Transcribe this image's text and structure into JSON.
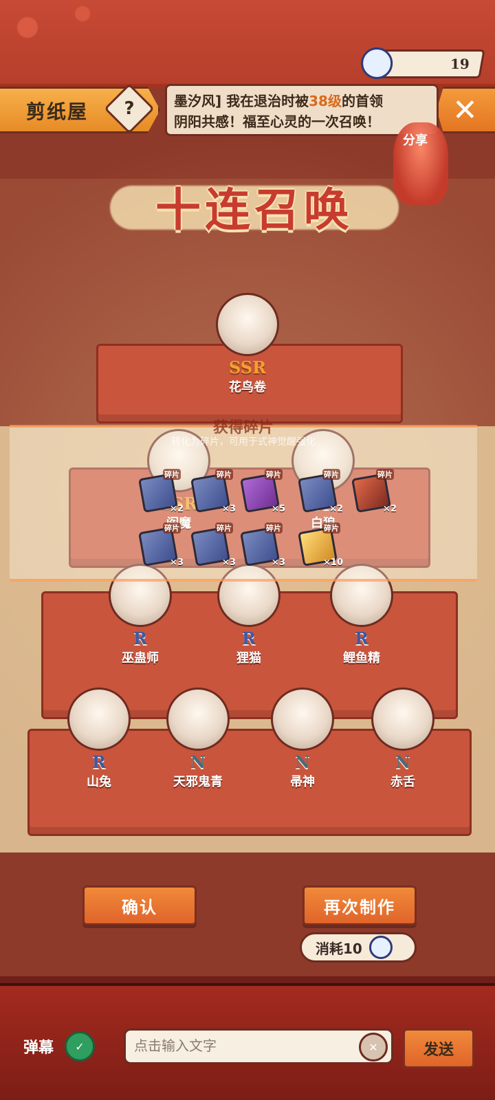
{
  "header": {
    "title": "剪纸屋",
    "help_symbol": "?",
    "close_symbol": "✕",
    "share_label": "分享",
    "currency_value": "19"
  },
  "ticker": {
    "line1_prefix": "墨汐风] 我在退治时被",
    "line1_level": "38级",
    "line1_suffix": "的首领",
    "line2": "阴阳共感！福至心灵的一次召唤！"
  },
  "summon": {
    "title": "十连召唤",
    "characters": [
      {
        "rarity": "SSR",
        "name": "花鸟卷"
      },
      {
        "rarity": "SSR",
        "name": "阎魔"
      },
      {
        "rarity": "SR",
        "name": "白狼"
      },
      {
        "rarity": "R",
        "name": "巫蛊师"
      },
      {
        "rarity": "R",
        "name": "狸猫"
      },
      {
        "rarity": "R",
        "name": "鲤鱼精"
      },
      {
        "rarity": "R",
        "name": "山兔"
      },
      {
        "rarity": "N",
        "name": "天邪鬼青"
      },
      {
        "rarity": "N",
        "name": "帚神"
      },
      {
        "rarity": "N",
        "name": "赤舌"
      }
    ]
  },
  "overlay": {
    "title": "获得碎片",
    "subtitle": "转化为碎片，可用于式神觉醒强化",
    "shards": [
      {
        "tag": "碎片",
        "count": "×2"
      },
      {
        "tag": "碎片",
        "count": "×3"
      },
      {
        "tag": "碎片",
        "count": "×5"
      },
      {
        "tag": "碎片",
        "count": "×2"
      },
      {
        "tag": "碎片",
        "count": "×2"
      },
      {
        "tag": "碎片",
        "count": "×3"
      },
      {
        "tag": "碎片",
        "count": "×3"
      },
      {
        "tag": "碎片",
        "count": "×3"
      },
      {
        "tag": "碎片",
        "count": "×10"
      }
    ]
  },
  "actions": {
    "confirm": "确认",
    "again": "再次制作",
    "cost_label": "消耗10"
  },
  "chat": {
    "label": "弹幕",
    "toggle_symbol": "✓",
    "placeholder": "点击输入文字",
    "clear_symbol": "✕",
    "send": "发送"
  }
}
